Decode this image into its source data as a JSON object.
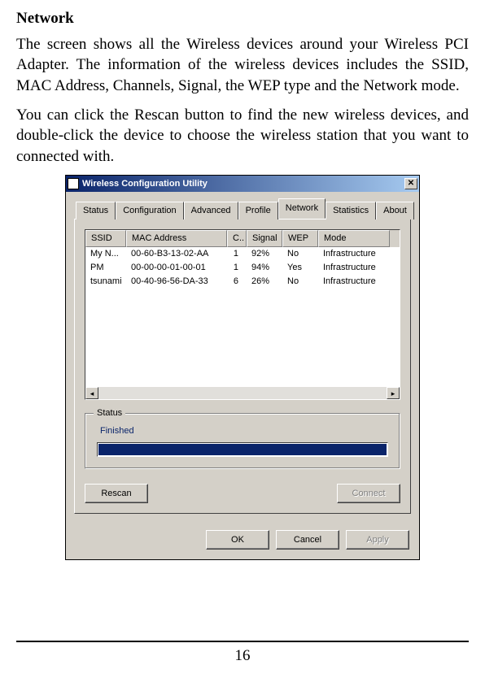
{
  "doc": {
    "heading": "Network",
    "para1": "The screen shows all the Wireless devices around your Wireless PCI Adapter. The information of the wireless devices includes the SSID, MAC Address, Channels, Signal, the WEP type and the Network mode.",
    "para2": "You can click the Rescan button to find the new wireless devices, and double-click the device to choose the wireless station that you want to connected with.",
    "page_number": "16"
  },
  "window": {
    "title": "Wireless Configuration Utility",
    "close_glyph": "✕",
    "tabs": {
      "status": "Status",
      "configuration": "Configuration",
      "advanced": "Advanced",
      "profile": "Profile",
      "network": "Network",
      "statistics": "Statistics",
      "about": "About"
    },
    "columns": {
      "ssid": "SSID",
      "mac": "MAC Address",
      "ch": "C..",
      "signal": "Signal",
      "wep": "WEP",
      "mode": "Mode"
    },
    "rows": [
      {
        "ssid": "My N...",
        "mac": "00-60-B3-13-02-AA",
        "ch": "1",
        "signal": "92%",
        "wep": "No",
        "mode": "Infrastructure"
      },
      {
        "ssid": "PM",
        "mac": "00-00-00-01-00-01",
        "ch": "1",
        "signal": "94%",
        "wep": "Yes",
        "mode": "Infrastructure"
      },
      {
        "ssid": "tsunami",
        "mac": "00-40-96-56-DA-33",
        "ch": "6",
        "signal": "26%",
        "wep": "No",
        "mode": "Infrastructure"
      }
    ],
    "scroll_left_glyph": "◂",
    "scroll_right_glyph": "▸",
    "status_group": {
      "legend": "Status",
      "text": "Finished"
    },
    "buttons": {
      "rescan": "Rescan",
      "connect": "Connect",
      "ok": "OK",
      "cancel": "Cancel",
      "apply": "Apply"
    }
  }
}
